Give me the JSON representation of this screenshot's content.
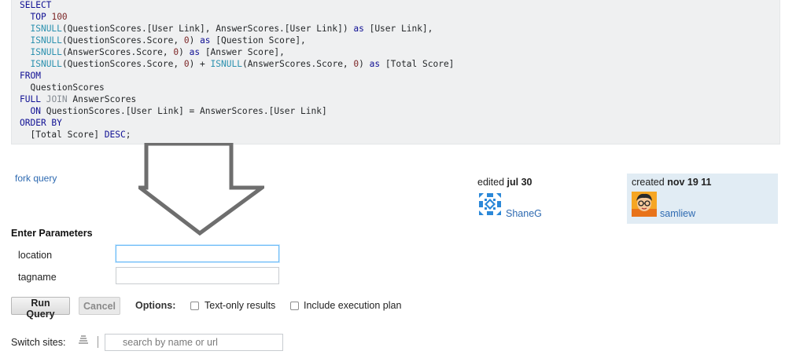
{
  "sql_lines": [
    [
      {
        "t": "SELECT",
        "c": "kw"
      }
    ],
    [
      {
        "t": "  "
      },
      {
        "t": "TOP",
        "c": "kw"
      },
      {
        "t": " "
      },
      {
        "t": "100",
        "c": "num"
      }
    ],
    [
      {
        "t": "  "
      },
      {
        "t": "ISNULL",
        "c": "fn"
      },
      {
        "t": "(QuestionScores.[User Link], AnswerScores.[User Link]) "
      },
      {
        "t": "as",
        "c": "kw"
      },
      {
        "t": " [User Link],"
      }
    ],
    [
      {
        "t": "  "
      },
      {
        "t": "ISNULL",
        "c": "fn"
      },
      {
        "t": "(QuestionScores.Score, "
      },
      {
        "t": "0",
        "c": "num"
      },
      {
        "t": ") "
      },
      {
        "t": "as",
        "c": "kw"
      },
      {
        "t": " [Question Score],"
      }
    ],
    [
      {
        "t": "  "
      },
      {
        "t": "ISNULL",
        "c": "fn"
      },
      {
        "t": "(AnswerScores.Score, "
      },
      {
        "t": "0",
        "c": "num"
      },
      {
        "t": ") "
      },
      {
        "t": "as",
        "c": "kw"
      },
      {
        "t": " [Answer Score],"
      }
    ],
    [
      {
        "t": "  "
      },
      {
        "t": "ISNULL",
        "c": "fn"
      },
      {
        "t": "(QuestionScores.Score, "
      },
      {
        "t": "0",
        "c": "num"
      },
      {
        "t": ") + "
      },
      {
        "t": "ISNULL",
        "c": "fn"
      },
      {
        "t": "(AnswerScores.Score, "
      },
      {
        "t": "0",
        "c": "num"
      },
      {
        "t": ") "
      },
      {
        "t": "as",
        "c": "kw"
      },
      {
        "t": " [Total Score]"
      }
    ],
    [
      {
        "t": "FROM",
        "c": "kw"
      }
    ],
    [
      {
        "t": "  QuestionScores"
      }
    ],
    [
      {
        "t": "FULL",
        "c": "kw"
      },
      {
        "t": " "
      },
      {
        "t": "JOIN",
        "c": "cmt"
      },
      {
        "t": " AnswerScores"
      }
    ],
    [
      {
        "t": "  "
      },
      {
        "t": "ON",
        "c": "kw"
      },
      {
        "t": " QuestionScores.[User Link] = AnswerScores.[User Link]"
      }
    ],
    [
      {
        "t": "ORDER BY",
        "c": "kw"
      }
    ],
    [
      {
        "t": "  [Total Score] "
      },
      {
        "t": "DESC",
        "c": "kw"
      },
      {
        "t": ";"
      }
    ]
  ],
  "fork_link": "fork query",
  "edited": {
    "action": "edited",
    "date": "jul 30",
    "user": "ShaneG",
    "avatar_icon": "identicon-icon",
    "accent": "#2b88d8"
  },
  "created": {
    "action": "created",
    "date": "nov 19 11",
    "user": "samliew",
    "avatar_icon": "cartoon-avatar-icon",
    "bg": "#e1ecf4"
  },
  "parameters": {
    "heading": "Enter Parameters",
    "fields": [
      {
        "label": "location",
        "value": "",
        "focused": true
      },
      {
        "label": "tagname",
        "value": "",
        "focused": false
      }
    ]
  },
  "actions": {
    "run_label": "Run Query",
    "cancel_label": "Cancel",
    "options_label": "Options:",
    "text_only_label": "Text-only results",
    "exec_plan_label": "Include execution plan"
  },
  "switch_sites": {
    "label": "Switch sites:",
    "placeholder": "search by name or url",
    "icon": "stack-icon"
  },
  "annotation": {
    "icon": "down-arrow-icon",
    "color": "#6e6e6e"
  }
}
